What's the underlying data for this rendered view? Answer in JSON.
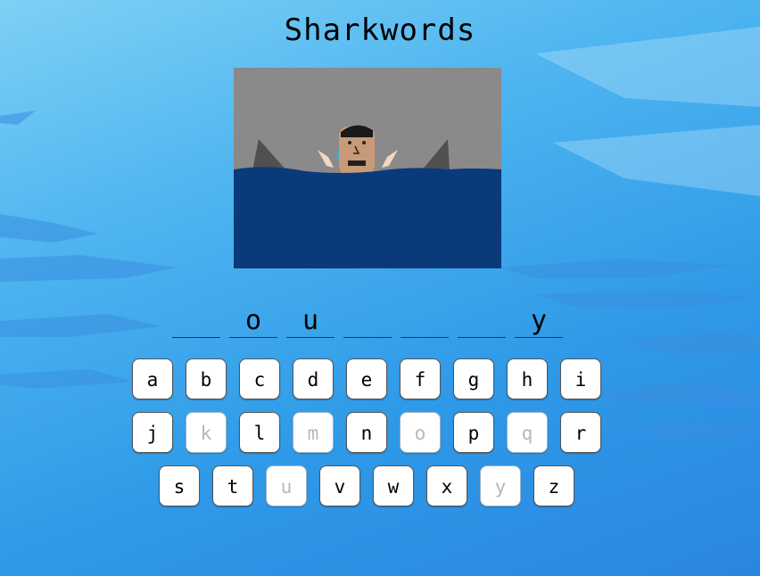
{
  "title": "Sharkwords",
  "word_slots": [
    "",
    "o",
    "u",
    "",
    "",
    "",
    "y"
  ],
  "keyboard": {
    "rows": [
      [
        {
          "letter": "a",
          "used": false
        },
        {
          "letter": "b",
          "used": false
        },
        {
          "letter": "c",
          "used": false
        },
        {
          "letter": "d",
          "used": false
        },
        {
          "letter": "e",
          "used": false
        },
        {
          "letter": "f",
          "used": false
        },
        {
          "letter": "g",
          "used": false
        },
        {
          "letter": "h",
          "used": false
        },
        {
          "letter": "i",
          "used": false
        }
      ],
      [
        {
          "letter": "j",
          "used": false
        },
        {
          "letter": "k",
          "used": true
        },
        {
          "letter": "l",
          "used": false
        },
        {
          "letter": "m",
          "used": true
        },
        {
          "letter": "n",
          "used": false
        },
        {
          "letter": "o",
          "used": true
        },
        {
          "letter": "p",
          "used": false
        },
        {
          "letter": "q",
          "used": true
        },
        {
          "letter": "r",
          "used": false
        }
      ],
      [
        {
          "letter": "s",
          "used": false
        },
        {
          "letter": "t",
          "used": false
        },
        {
          "letter": "u",
          "used": true
        },
        {
          "letter": "v",
          "used": false
        },
        {
          "letter": "w",
          "used": false
        },
        {
          "letter": "x",
          "used": false
        },
        {
          "letter": "y",
          "used": true
        },
        {
          "letter": "z",
          "used": false
        }
      ]
    ]
  },
  "colors": {
    "sky": "#8a8a8a",
    "water": "#0b3a7a",
    "fin": "#555555",
    "skin": "#d2a07a"
  }
}
